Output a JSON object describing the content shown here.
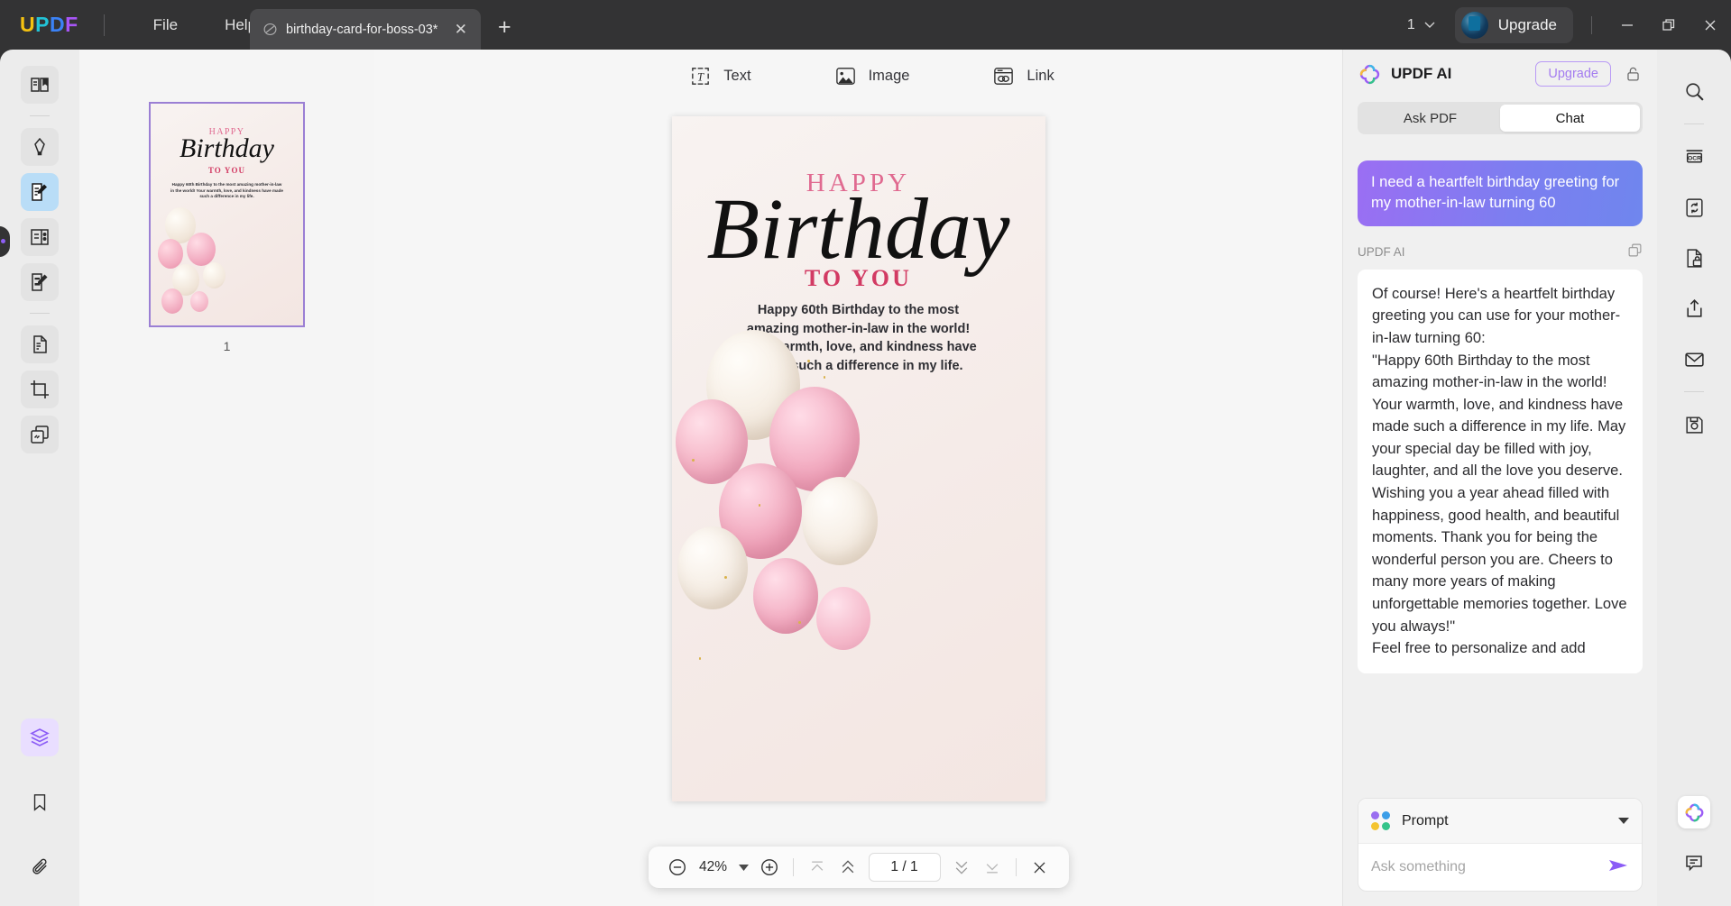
{
  "titlebar": {
    "logo_letters": [
      "U",
      "P",
      "D",
      "F"
    ],
    "menus": [
      {
        "label": "File",
        "name": "menu-file"
      },
      {
        "label": "Help",
        "name": "menu-help"
      }
    ],
    "tab": {
      "title": "birthday-card-for-boss-03*",
      "icon": "pdf-doc-icon",
      "close_label": "✕"
    },
    "new_tab_label": "+",
    "window_count": "1",
    "upgrade_label": "Upgrade",
    "window_controls": [
      "minimize",
      "maximize",
      "close"
    ]
  },
  "left_rail": {
    "items": [
      {
        "name": "sidebar-item-reader",
        "icon": "book-reader-icon",
        "selected": false
      },
      {
        "name": "sidebar-item-comment",
        "icon": "highlighter-pen-icon",
        "selected": false
      },
      {
        "name": "sidebar-item-edit-pdf",
        "icon": "edit-document-icon",
        "selected": true
      },
      {
        "name": "sidebar-item-organize-pages",
        "icon": "page-list-icon",
        "selected": false
      },
      {
        "name": "sidebar-item-form",
        "icon": "form-edit-icon",
        "selected": false
      },
      {
        "name": "sidebar-item-convert",
        "icon": "convert-file-icon",
        "selected": false
      },
      {
        "name": "sidebar-item-crop",
        "icon": "crop-icon",
        "selected": false
      },
      {
        "name": "sidebar-item-batch",
        "icon": "stacked-pages-icon",
        "selected": false
      }
    ],
    "bottom_items": [
      {
        "name": "sidebar-item-layers",
        "icon": "layers-icon",
        "selected": true
      },
      {
        "name": "sidebar-item-bookmarks",
        "icon": "bookmark-icon",
        "selected": false
      },
      {
        "name": "sidebar-item-attachments",
        "icon": "paperclip-icon",
        "selected": false
      }
    ]
  },
  "thumbnails": {
    "pages": [
      {
        "number": "1",
        "selected": true
      }
    ]
  },
  "edit_toolbar": {
    "items": [
      {
        "label": "Text",
        "icon": "text-box-icon",
        "name": "edit-tool-text"
      },
      {
        "label": "Image",
        "icon": "image-icon",
        "name": "edit-tool-image"
      },
      {
        "label": "Link",
        "icon": "link-icon",
        "name": "edit-tool-link"
      }
    ]
  },
  "document": {
    "card": {
      "happy": "HAPPY",
      "birthday": "Birthday",
      "to_you": "TO YOU",
      "message": "Happy 60th Birthday to the most amazing mother-in-law in the world! Your warmth, love, and kindness have made such a difference in my life."
    }
  },
  "zoom_bar": {
    "zoom_out": "zoom-out-icon",
    "zoom_level": "42%",
    "zoom_dropdown": "chevron-down-icon",
    "zoom_in": "zoom-in-icon",
    "first_page": "first-page-icon",
    "prev_page": "previous-page-icon",
    "page_indicator": "1 / 1",
    "next_page": "next-page-icon",
    "last_page": "last-page-icon",
    "close": "close-icon"
  },
  "ai_panel": {
    "title": "UPDF AI",
    "logo": "updf-ai-clover-icon",
    "upgrade_label": "Upgrade",
    "lock_icon": "lock-icon",
    "tabs": [
      {
        "label": "Ask PDF",
        "selected": false,
        "name": "tab-ask-pdf"
      },
      {
        "label": "Chat",
        "selected": true,
        "name": "tab-chat"
      }
    ],
    "messages": [
      {
        "role": "user",
        "text": "I need a heartfelt birthday greeting for my mother-in-law turning 60"
      },
      {
        "role": "assistant",
        "sender_label": "UPDF AI",
        "copy_icon": "copy-icon",
        "paragraphs": [
          "Of course! Here's a heartfelt birthday greeting you can use for your mother-in-law turning 60:",
          "\"Happy 60th Birthday to the most amazing mother-in-law in the world! Your warmth, love, and kindness have made such a difference in my life. May your special day be filled with joy, laughter, and all the love you deserve. Wishing you a year ahead filled with happiness, good health, and beautiful moments. Thank you for being the wonderful person you are. Cheers to many more years of making unforgettable memories together. Love you always!\"",
          "Feel free to personalize and add"
        ]
      }
    ],
    "prompt": {
      "label": "Prompt",
      "icon": "four-dots-icon",
      "caret": "chevron-down-icon",
      "dot_colors": [
        "#9a6ef0",
        "#3b9ee8",
        "#f4c430",
        "#34c48a"
      ]
    },
    "input": {
      "placeholder": "Ask something",
      "send_icon": "send-arrow-icon"
    }
  },
  "right_rail": {
    "items": [
      {
        "name": "right-tool-search",
        "icon": "search-icon"
      },
      {
        "name": "right-tool-ocr",
        "icon": "ocr-icon"
      },
      {
        "name": "right-tool-convert",
        "icon": "convert-refresh-icon"
      },
      {
        "name": "right-tool-protect",
        "icon": "lock-document-icon"
      },
      {
        "name": "right-tool-share",
        "icon": "share-icon"
      },
      {
        "name": "right-tool-email",
        "icon": "envelope-icon"
      },
      {
        "name": "right-tool-save",
        "icon": "save-disk-icon"
      }
    ],
    "bottom_items": [
      {
        "name": "right-tool-updf-ai",
        "icon": "updf-ai-clover-icon"
      },
      {
        "name": "right-tool-feedback",
        "icon": "comment-bubble-icon"
      }
    ]
  },
  "colors": {
    "titlebar_bg": "#333334",
    "accent_purple": "#8e5ff5",
    "card_pink": "#d23a63",
    "selected_blue": "#b9ddf7"
  }
}
